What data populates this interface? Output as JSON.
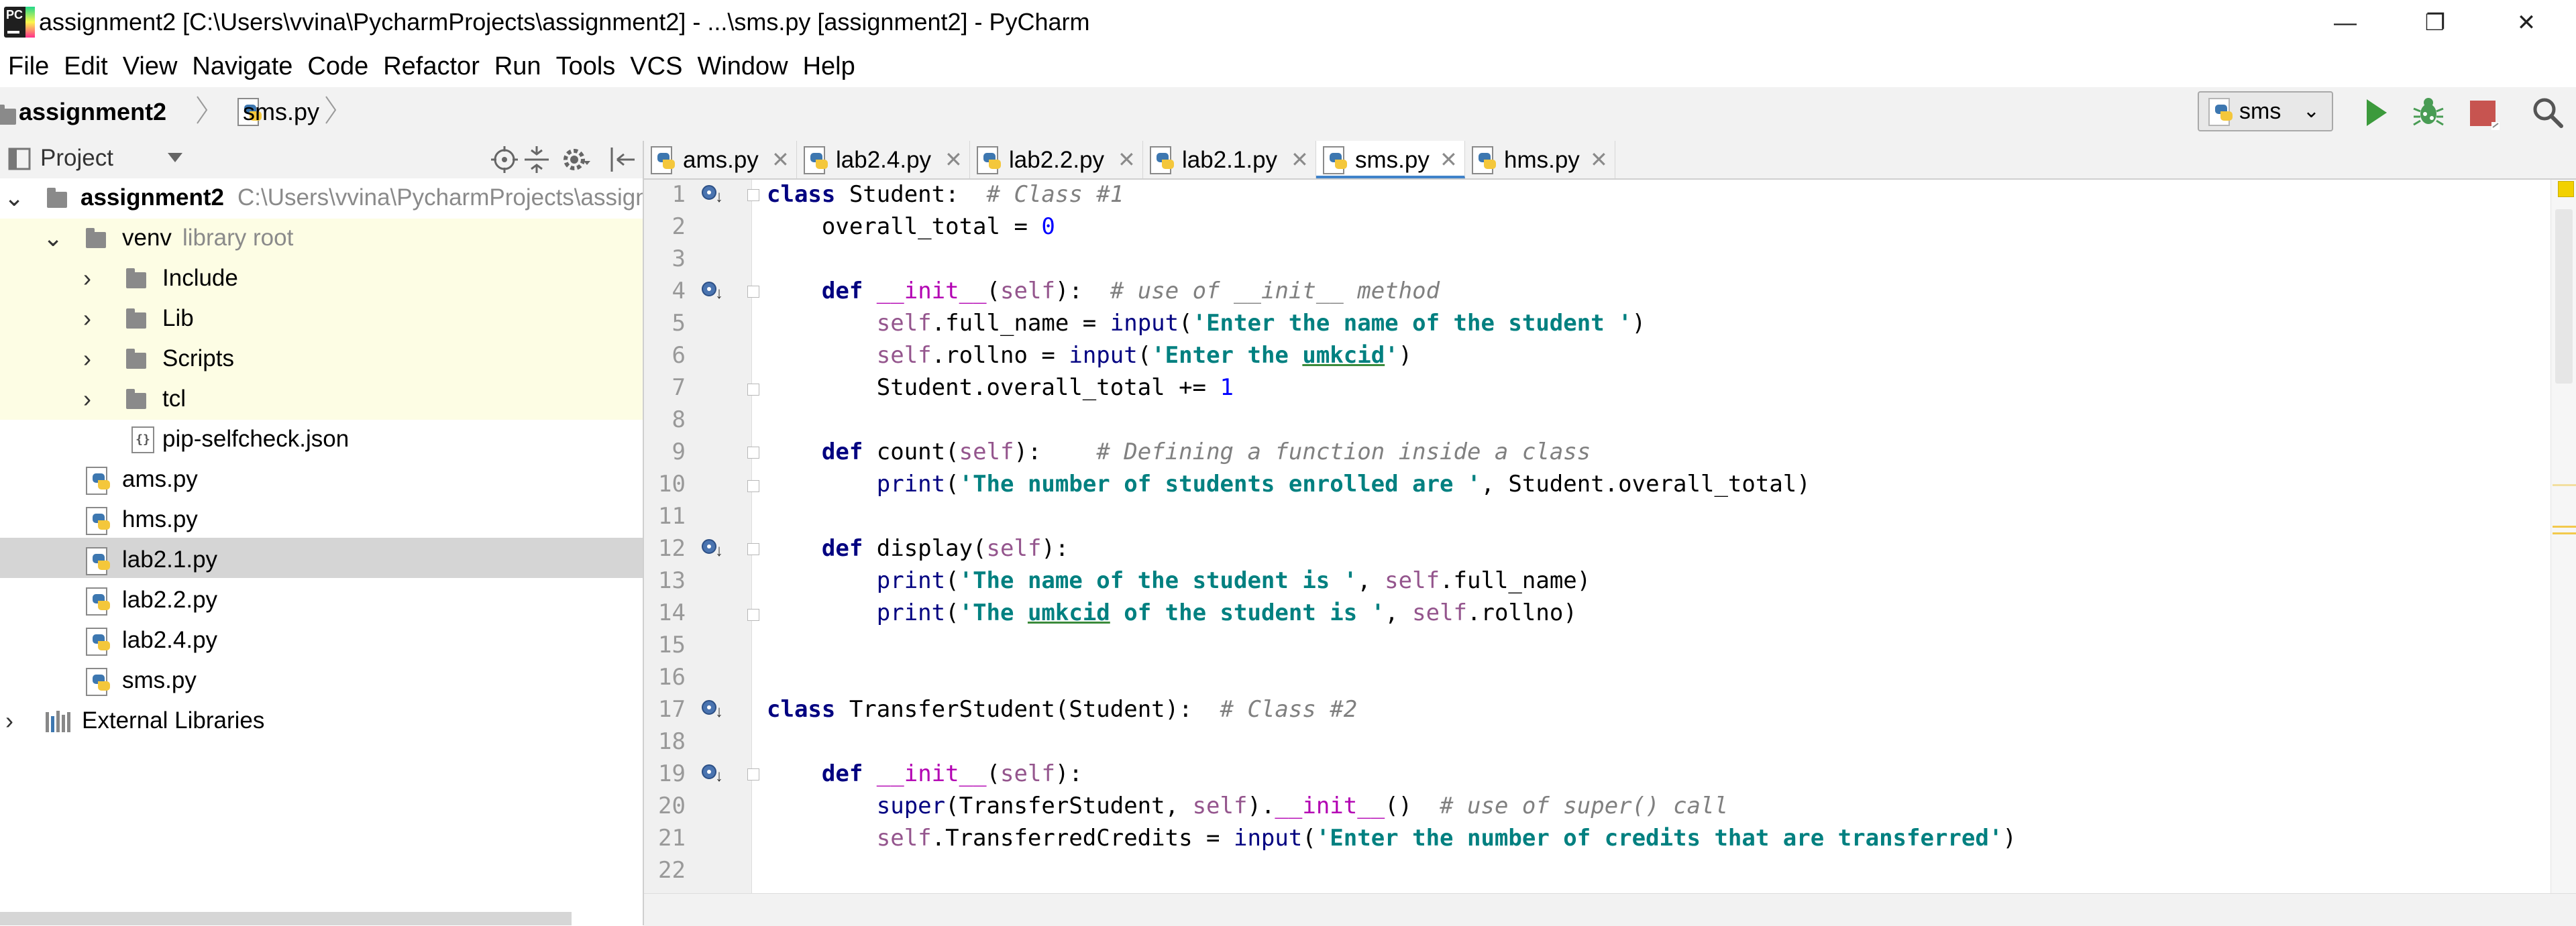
{
  "window": {
    "title": "assignment2 [C:\\Users\\vvina\\PycharmProjects\\assignment2] - ...\\sms.py [assignment2] - PyCharm",
    "logo_text": "PC",
    "minimize": "—",
    "restore": "❐",
    "close": "✕"
  },
  "menu": [
    "File",
    "Edit",
    "View",
    "Navigate",
    "Code",
    "Refactor",
    "Run",
    "Tools",
    "VCS",
    "Window",
    "Help"
  ],
  "breadcrumb": {
    "project": "assignment2",
    "file": "sms.py"
  },
  "run_config": {
    "selected": "sms"
  },
  "colors": {
    "run": "#3c9a3c",
    "debug": "#499c54",
    "stop": "#c75450",
    "tab_underline": "#4083c9",
    "venv_bg": "#fdfde4"
  },
  "project_panel": {
    "title": "Project",
    "tree": [
      {
        "label": "assignment2",
        "extra": "C:\\Users\\vvina\\PycharmProjects\\assign",
        "type": "folder",
        "expanded": true,
        "depth": 0
      },
      {
        "label": "venv",
        "extra": "library root",
        "type": "folder",
        "expanded": true,
        "depth": 1
      },
      {
        "label": "Include",
        "extra": "",
        "type": "folder",
        "expanded": false,
        "depth": 2
      },
      {
        "label": "Lib",
        "extra": "",
        "type": "folder",
        "expanded": false,
        "depth": 2
      },
      {
        "label": "Scripts",
        "extra": "",
        "type": "folder",
        "expanded": false,
        "depth": 2
      },
      {
        "label": "tcl",
        "extra": "",
        "type": "folder",
        "expanded": false,
        "depth": 2
      },
      {
        "label": "pip-selfcheck.json",
        "extra": "",
        "type": "json",
        "depth": 2
      },
      {
        "label": "ams.py",
        "extra": "",
        "type": "py",
        "depth": 1
      },
      {
        "label": "hms.py",
        "extra": "",
        "type": "py",
        "depth": 1
      },
      {
        "label": "lab2.1.py",
        "extra": "",
        "type": "py",
        "depth": 1,
        "selected": true
      },
      {
        "label": "lab2.2.py",
        "extra": "",
        "type": "py",
        "depth": 1
      },
      {
        "label": "lab2.4.py",
        "extra": "",
        "type": "py",
        "depth": 1
      },
      {
        "label": "sms.py",
        "extra": "",
        "type": "py",
        "depth": 1
      },
      {
        "label": "External Libraries",
        "extra": "",
        "type": "libs",
        "expanded": false,
        "depth": 0
      }
    ]
  },
  "tabs": [
    {
      "label": "ams.py",
      "active": false
    },
    {
      "label": "lab2.4.py",
      "active": false
    },
    {
      "label": "lab2.2.py",
      "active": false
    },
    {
      "label": "lab2.1.py",
      "active": false
    },
    {
      "label": "sms.py",
      "active": true
    },
    {
      "label": "hms.py",
      "active": false
    }
  ],
  "editor": {
    "line_numbers": [
      "1",
      "2",
      "3",
      "4",
      "5",
      "6",
      "7",
      "8",
      "9",
      "10",
      "11",
      "12",
      "13",
      "14",
      "15",
      "16",
      "17",
      "18",
      "19",
      "20",
      "21",
      "22"
    ],
    "code": {
      "l1_kw": "class",
      "l1_name": " Student:  ",
      "l1_cm": "# Class #1",
      "l2_a": "    overall_total = ",
      "l2_num": "0",
      "l4_kw": "    def",
      "l4_sp": " ",
      "l4_mg": "__init__",
      "l4_p1": "(",
      "l4_self": "self",
      "l4_p2": "):  ",
      "l4_cm": "# use of __init__ method",
      "l5_self": "        self",
      "l5_a": ".full_name = ",
      "l5_bi": "input",
      "l5_p": "(",
      "l5_st": "'Enter the name of the student '",
      "l5_e": ")",
      "l6_self": "        self",
      "l6_a": ".rollno = ",
      "l6_bi": "input",
      "l6_p": "(",
      "l6_st1": "'Enter the ",
      "l6_ul": "umkcid",
      "l6_st2": "'",
      "l6_e": ")",
      "l7_a": "        Student.overall_total += ",
      "l7_num": "1",
      "l9_kw": "    def",
      "l9_a": " count(",
      "l9_self": "self",
      "l9_b": "):    ",
      "l9_cm": "# Defining a function inside a class",
      "l10_bi": "        print",
      "l10_p": "(",
      "l10_st": "'The number of students enrolled are '",
      "l10_e": ", Student.overall_total)",
      "l12_kw": "    def",
      "l12_a": " display(",
      "l12_self": "self",
      "l12_b": "):",
      "l13_bi": "        print",
      "l13_p": "(",
      "l13_st": "'The name of the student is '",
      "l13_c": ", ",
      "l13_self": "self",
      "l13_e": ".full_name)",
      "l14_bi": "        print",
      "l14_p": "(",
      "l14_st1": "'The ",
      "l14_ul": "umkcid",
      "l14_st2": " of the student is '",
      "l14_c": ", ",
      "l14_self": "self",
      "l14_e": ".rollno)",
      "l17_kw": "class",
      "l17_a": " TransferStudent(Student):  ",
      "l17_cm": "# Class #2",
      "l19_kw": "    def",
      "l19_sp": " ",
      "l19_mg": "__init__",
      "l19_p1": "(",
      "l19_self": "self",
      "l19_p2": "):",
      "l20_bi": "        super",
      "l20_a": "(TransferStudent, ",
      "l20_self": "self",
      "l20_b": ").",
      "l20_mg": "__init__",
      "l20_c": "()  ",
      "l20_cm": "# use of super() call",
      "l21_self": "        self",
      "l21_a": ".TransferredCredits = ",
      "l21_bi": "input",
      "l21_p": "(",
      "l21_st": "'Enter the number of credits that are transferred'",
      "l21_e": ")"
    }
  }
}
